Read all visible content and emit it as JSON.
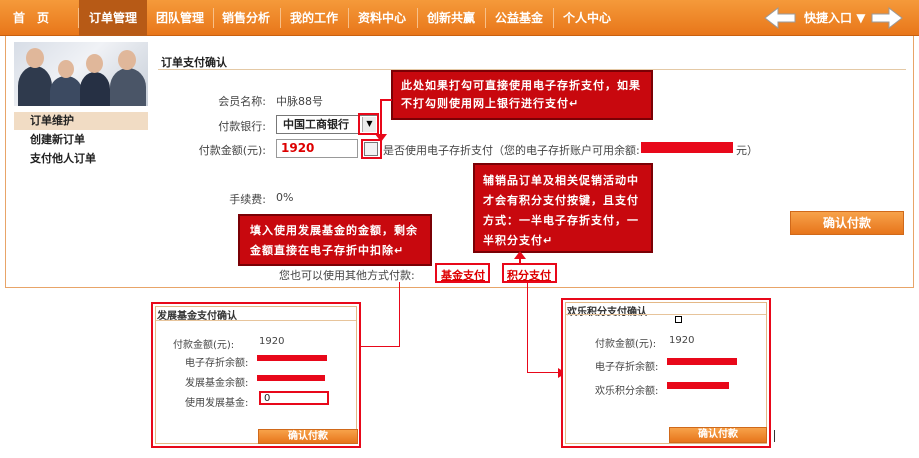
{
  "nav": {
    "items": [
      "首　页",
      "订单管理",
      "团队管理",
      "销售分析",
      "我的工作",
      "资料中心",
      "创新共赢",
      "公益基金",
      "个人中心"
    ],
    "active_index": 1,
    "quick_entry": "快捷入口"
  },
  "sidebar": {
    "items": [
      "订单维护",
      "创建新订单",
      "支付他人订单"
    ],
    "active_index": 0
  },
  "form": {
    "title": "订单支付确认",
    "member_label": "会员名称:",
    "member_value": "中脉88号",
    "bank_label": "付款银行:",
    "bank_value": "中国工商银行",
    "amount_label": "付款金额(元):",
    "amount_value": "1920",
    "ewallet_text": "是否使用电子存折支付（您的电子存折账户可用余额:",
    "ewallet_suffix": "元）",
    "fee_label": "手续费:",
    "fee_value": "0%",
    "other_methods_label": "您也可以使用其他方式付款:",
    "fund_pay_link": "基金支付",
    "points_pay_link": "积分支付",
    "confirm_button": "确认付款"
  },
  "callouts": {
    "checkbox_note": "此处如果打勾可直接使用电子存折支付，如果不打勾则使用网上银行进行支付↵",
    "fund_note": "填入使用发展基金的金额，剩余金额直接在电子存折中扣除↵",
    "points_note": "辅销品订单及相关促销活动中才会有积分支付按键，且支付方式：一半电子存折支付，一半积分支付↵"
  },
  "fund_panel": {
    "title": "发展基金支付确认",
    "amount_label": "付款金额(元):",
    "amount_value": "1920",
    "ewallet_label": "电子存折余额:",
    "fund_balance_label": "发展基金余额:",
    "use_fund_label": "使用发展基金:",
    "use_fund_value": "0",
    "confirm_button": "确认付款"
  },
  "points_panel": {
    "title": "欢乐积分支付确认",
    "amount_label": "付款金额(元):",
    "amount_value": "1920",
    "ewallet_label": "电子存折余额:",
    "points_balance_label": "欢乐积分余额:",
    "confirm_button": "确认付款"
  },
  "colors": {
    "nav_orange": "#e8761a",
    "active_nav": "#b75a16",
    "redaction_red": "#e8081a",
    "callout_red": "#c8080e"
  }
}
